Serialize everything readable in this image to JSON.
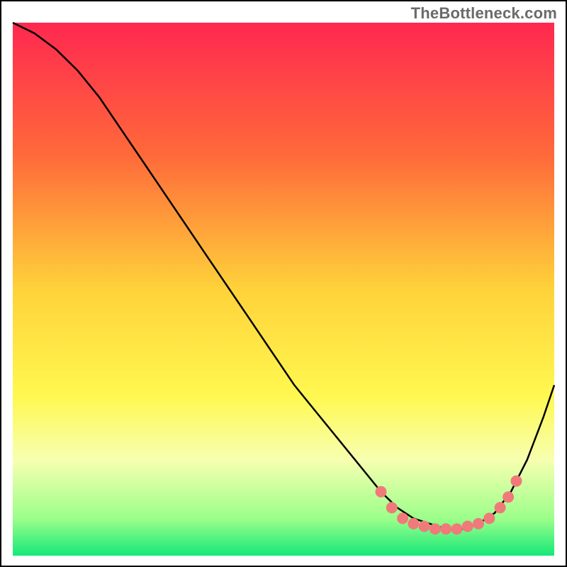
{
  "watermark": "TheBottleneck.com",
  "chart_data": {
    "type": "line",
    "title": "",
    "xlabel": "",
    "ylabel": "",
    "xlim": [
      0,
      100
    ],
    "ylim": [
      0,
      100
    ],
    "background_gradient": {
      "stops": [
        {
          "offset": 0.0,
          "color": "#ff2850"
        },
        {
          "offset": 0.25,
          "color": "#ff6a3a"
        },
        {
          "offset": 0.5,
          "color": "#ffd23a"
        },
        {
          "offset": 0.7,
          "color": "#fff850"
        },
        {
          "offset": 0.82,
          "color": "#f7ffb0"
        },
        {
          "offset": 0.93,
          "color": "#9cff8a"
        },
        {
          "offset": 1.0,
          "color": "#16e87a"
        }
      ]
    },
    "series": [
      {
        "name": "curve",
        "color": "#000000",
        "x": [
          0,
          4,
          8,
          12,
          16,
          20,
          24,
          28,
          32,
          36,
          40,
          44,
          48,
          52,
          56,
          60,
          64,
          68,
          71,
          74,
          77,
          80,
          83,
          86,
          89,
          92,
          95,
          98,
          100
        ],
        "y": [
          100,
          98,
          95,
          91,
          86,
          80,
          74,
          68,
          62,
          56,
          50,
          44,
          38,
          32,
          27,
          22,
          17,
          12,
          9,
          7,
          6,
          5,
          5,
          6,
          8,
          12,
          18,
          26,
          32
        ]
      }
    ],
    "markers": {
      "name": "dots",
      "color": "#f07a7a",
      "radius": 8,
      "points": [
        {
          "x": 68,
          "y": 12
        },
        {
          "x": 70,
          "y": 9
        },
        {
          "x": 72,
          "y": 7
        },
        {
          "x": 74,
          "y": 6
        },
        {
          "x": 76,
          "y": 5.5
        },
        {
          "x": 78,
          "y": 5
        },
        {
          "x": 80,
          "y": 5
        },
        {
          "x": 82,
          "y": 5
        },
        {
          "x": 84,
          "y": 5.5
        },
        {
          "x": 86,
          "y": 6
        },
        {
          "x": 88,
          "y": 7
        },
        {
          "x": 90,
          "y": 9
        },
        {
          "x": 91.5,
          "y": 11
        },
        {
          "x": 93,
          "y": 14
        }
      ]
    }
  }
}
